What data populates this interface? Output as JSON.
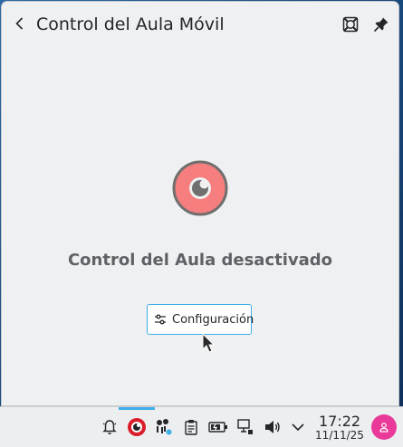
{
  "popup": {
    "title": "Control del Aula Móvil",
    "status_text": "Control del Aula desactivado",
    "config_button_label": "Configuración",
    "header_buttons": [
      "lifebuoy-icon",
      "pin-icon"
    ]
  },
  "status": {
    "icon": "eye-disabled-icon",
    "color": "#f67e7e"
  },
  "taskbar": {
    "tray_icons": [
      "notification-bell-icon",
      "classroom-control-icon",
      "fingerprint-network-icon",
      "clipboard-icon",
      "battery-icon",
      "network-wired-icon",
      "volume-icon",
      "chevron-down-icon"
    ],
    "clock": {
      "time": "17:22",
      "date": "11/11/25"
    },
    "accent_color": "#3daee9"
  }
}
